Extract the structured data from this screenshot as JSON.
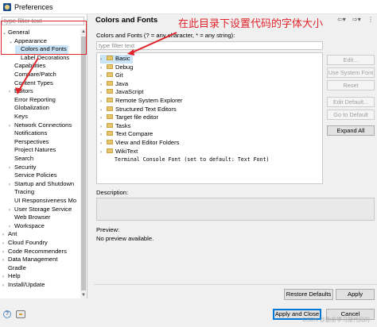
{
  "window": {
    "title": "Preferences"
  },
  "left": {
    "filter_placeholder": "type filter text",
    "tree": [
      {
        "label": "General",
        "twisty": "open"
      },
      {
        "label": "Appearance",
        "twisty": "open"
      },
      {
        "label": "Colors and Fonts",
        "twisty": "",
        "selected": true
      },
      {
        "label": "Label Decorations",
        "twisty": ""
      },
      {
        "label": "Capabilities",
        "twisty": ""
      },
      {
        "label": "Compare/Patch",
        "twisty": ""
      },
      {
        "label": "Content Types",
        "twisty": ""
      },
      {
        "label": "Editors",
        "twisty": "closed"
      },
      {
        "label": "Error Reporting",
        "twisty": ""
      },
      {
        "label": "Globalization",
        "twisty": ""
      },
      {
        "label": "Keys",
        "twisty": ""
      },
      {
        "label": "Network Connections",
        "twisty": "closed"
      },
      {
        "label": "Notifications",
        "twisty": ""
      },
      {
        "label": "Perspectives",
        "twisty": ""
      },
      {
        "label": "Project Natures",
        "twisty": ""
      },
      {
        "label": "Search",
        "twisty": ""
      },
      {
        "label": "Security",
        "twisty": "closed"
      },
      {
        "label": "Service Policies",
        "twisty": ""
      },
      {
        "label": "Startup and Shutdown",
        "twisty": "closed"
      },
      {
        "label": "Tracing",
        "twisty": ""
      },
      {
        "label": "UI Responsiveness Mo",
        "twisty": ""
      },
      {
        "label": "User Storage Service",
        "twisty": "closed"
      },
      {
        "label": "Web Browser",
        "twisty": ""
      },
      {
        "label": "Workspace",
        "twisty": "closed"
      },
      {
        "label": "Ant",
        "twisty": "closed"
      },
      {
        "label": "Cloud Foundry",
        "twisty": "closed"
      },
      {
        "label": "Code Recommenders",
        "twisty": "closed"
      },
      {
        "label": "Data Management",
        "twisty": "closed"
      },
      {
        "label": "Gradle",
        "twisty": ""
      },
      {
        "label": "Help",
        "twisty": "closed"
      },
      {
        "label": "Install/Update",
        "twisty": "closed"
      }
    ]
  },
  "main": {
    "title": "Colors and Fonts",
    "annotation": "在此目录下设置代码的字体大小",
    "description": "Colors and Fonts (? = any character, * = any string):",
    "filter_placeholder": "type filter text",
    "font_tree": [
      {
        "label": "Basic",
        "selected": true
      },
      {
        "label": "Debug"
      },
      {
        "label": "Git"
      },
      {
        "label": "Java"
      },
      {
        "label": "JavaScript"
      },
      {
        "label": "Remote System Explorer"
      },
      {
        "label": "Structured Text Editors"
      },
      {
        "label": "Target file editor"
      },
      {
        "label": "Tasks"
      },
      {
        "label": "Text Compare"
      },
      {
        "label": "View and Editor Folders"
      },
      {
        "label": "WikiText"
      },
      {
        "label": "Terminal Console Font (set to default: Text Font)",
        "leaf": true
      }
    ],
    "buttons": {
      "edit": "Edit...",
      "use_system_font": "Use System Font",
      "reset": "Reset",
      "edit_default": "Edit Default...",
      "go_to_default": "Go to Default",
      "expand_all": "Expand All"
    },
    "description_label": "Description:",
    "preview_label": "Preview:",
    "preview_text": "No preview available.",
    "restore_defaults": "Restore Defaults",
    "apply": "Apply"
  },
  "footer": {
    "apply_close": "Apply and Close",
    "cancel": "Cancel",
    "watermark": "CSDN @勤奋学习敲代码的"
  },
  "icons": [
    "back-icon",
    "forward-icon",
    "menu-icon",
    "help-icon",
    "import-export-icon"
  ]
}
